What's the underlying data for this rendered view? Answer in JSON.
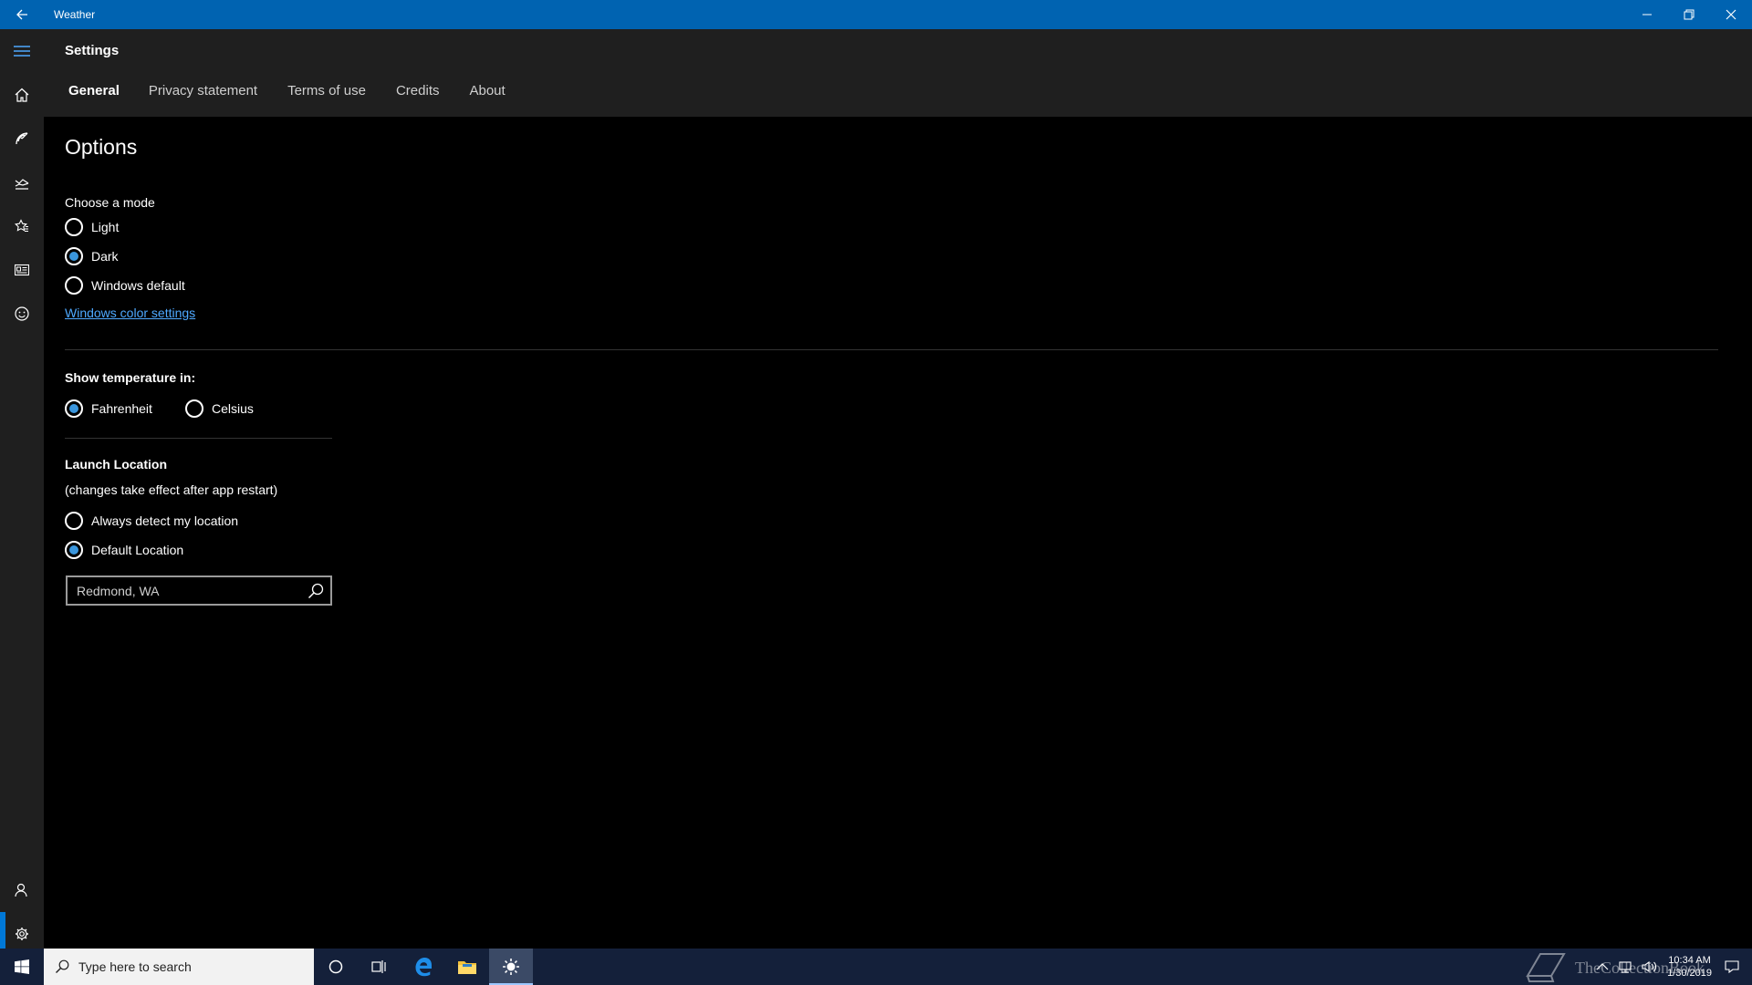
{
  "window": {
    "title": "Weather"
  },
  "header": {
    "title": "Settings",
    "tabs": [
      "General",
      "Privacy statement",
      "Terms of use",
      "Credits",
      "About"
    ],
    "active_tab": "General"
  },
  "options": {
    "heading": "Options",
    "mode": {
      "label": "Choose a mode",
      "choices": [
        "Light",
        "Dark",
        "Windows default"
      ],
      "selected": "Dark"
    },
    "color_link": "Windows color settings",
    "temperature": {
      "label": "Show temperature in:",
      "choices": [
        "Fahrenheit",
        "Celsius"
      ],
      "selected": "Fahrenheit"
    },
    "launch": {
      "label": "Launch Location",
      "note": "(changes take effect after app restart)",
      "choices": [
        "Always detect my location",
        "Default Location"
      ],
      "selected": "Default Location",
      "location_value": "Redmond, WA"
    }
  },
  "taskbar": {
    "search_placeholder": "Type here to search",
    "time": "10:34 AM",
    "date": "1/30/2019",
    "watermark": "TheCollectionBook"
  },
  "colors": {
    "titlebar": "#0063b1",
    "accent": "#3a96dd",
    "link": "#4ea9ff",
    "taskbar": "#14203a"
  },
  "icons": {
    "rail": [
      "hamburger-icon",
      "home-icon",
      "radar-icon",
      "historical-icon",
      "favorites-icon",
      "news-icon",
      "feedback-icon",
      "account-icon",
      "settings-icon"
    ]
  }
}
